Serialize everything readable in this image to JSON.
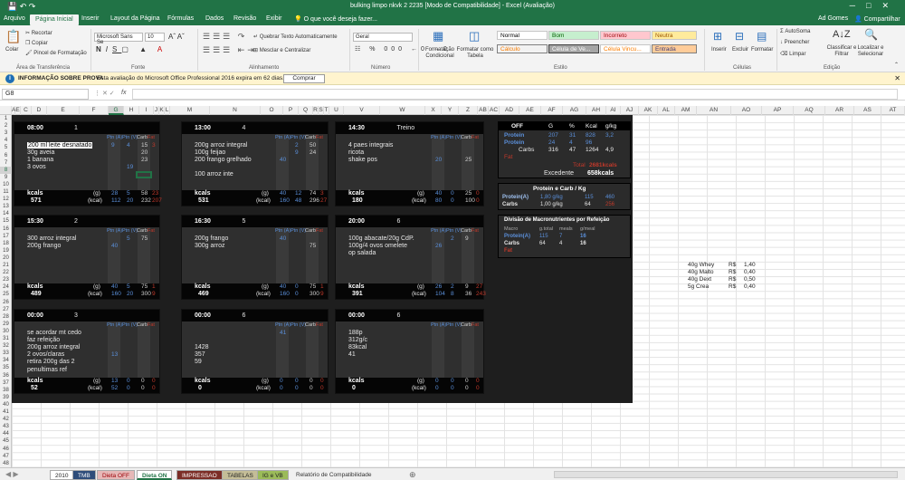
{
  "title": {
    "text": "bulking limpo nkvk 2 2235 [Modo de Compatibilidade] - Excel (Avaliação)",
    "user": "Ad Gomes",
    "share": "Compartilhar"
  },
  "tabs": [
    "Arquivo",
    "Página Inicial",
    "Inserir",
    "Layout da Página",
    "Fórmulas",
    "Dados",
    "Revisão",
    "Exibir",
    "O que você deseja fazer..."
  ],
  "ribbon": {
    "paste": "Colar",
    "cut": "Recortar",
    "copy": "Copiar",
    "painter": "Pincel de Formatação",
    "g_clip": "Área de Transferência",
    "font": "Microsoft Sans Se",
    "size": "10",
    "g_font": "Fonte",
    "wrap": "Quebrar Texto Automaticamente",
    "merge": "Mesclar e Centralizar",
    "g_align": "Alinhamento",
    "numfmt": "Geral",
    "g_num": "Número",
    "cond": "Formatação Condicional",
    "astable": "Formatar como Tabela",
    "styles": [
      "Normal",
      "Bom",
      "Incorreto",
      "Neutra",
      "Cálculo",
      "Célula de Ve...",
      "Célula Vincu...",
      "Entrada"
    ],
    "g_styles": "Estilo",
    "insert": "Inserir",
    "delete": "Excluir",
    "format": "Formatar",
    "g_cells": "Células",
    "autosum": "AutoSoma",
    "fill": "Preencher",
    "clear": "Limpar",
    "sort": "Classificar e Filtrar",
    "find": "Localizar e Selecionar",
    "g_edit": "Edição"
  },
  "info": {
    "label": "INFORMAÇÃO SOBRE PROVA",
    "text": "Esta avaliação do Microsoft Office Professional 2016 expira em 62 dias.",
    "button": "Comprar"
  },
  "formula": {
    "namebox": "G8",
    "fx": "fx"
  },
  "columns": [
    "A",
    "E",
    "C",
    "D",
    "E",
    "F",
    "G",
    "H",
    "I",
    "J",
    "K",
    "L",
    "M",
    "N",
    "O",
    "P",
    "Q",
    "R",
    "S",
    "T",
    "U",
    "V",
    "W",
    "X",
    "Y",
    "Z",
    "AB",
    "AC",
    "AD",
    "AE",
    "AF",
    "AG",
    "AH",
    "AI",
    "AJ",
    "AK",
    "AL",
    "AM",
    "AN",
    "AO",
    "AP",
    "AQ",
    "AR",
    "AS",
    "AT"
  ],
  "rows": [
    "1",
    "2",
    "3",
    "4",
    "5",
    "6",
    "7",
    "8",
    "9",
    "10",
    "11",
    "12",
    "13",
    "14",
    "15",
    "16",
    "17",
    "18",
    "19",
    "20",
    "21",
    "22",
    "23",
    "24",
    "25",
    "26",
    "27",
    "28",
    "29",
    "30",
    "31",
    "32",
    "33",
    "34",
    "35",
    "36",
    "37",
    "38",
    "39",
    "40",
    "41",
    "42",
    "43",
    "44",
    "45",
    "46",
    "47",
    "48"
  ],
  "hdr": {
    "ptn_a": "Ptn (A)",
    "ptn_v": "Ptn (V)",
    "carb": "Carb",
    "fat": "Fat",
    "kcals": "kcals",
    "g": "(g)",
    "kcal": "(kcal)"
  },
  "meals": [
    {
      "time": "08:00",
      "num": "1",
      "items": [
        "200 ml  leite desnatado",
        "30g  aveia",
        "1  banana",
        "3 ovos"
      ],
      "cols": [
        [
          "9",
          "",
          "",
          ""
        ],
        [
          "4",
          "",
          "",
          "19"
        ],
        [
          "15",
          "20",
          "23",
          ""
        ],
        [
          "3",
          "",
          "",
          ""
        ]
      ],
      "kcals": "571",
      "g": [
        "28",
        "5",
        "58",
        "23"
      ],
      "kcal": [
        "112",
        "20",
        "232",
        "207"
      ]
    },
    {
      "time": "13:00",
      "num": "4",
      "items": [
        "200g arroz integral",
        "100g feijao",
        "200 frango grelhado",
        "",
        "100 arroz inte"
      ],
      "cols": [
        [
          "",
          "",
          "40",
          ""
        ],
        [
          "2",
          "9",
          "",
          ""
        ],
        [
          "50",
          "24",
          "",
          ""
        ],
        [
          "",
          "",
          "",
          ""
        ]
      ],
      "kcals": "531",
      "g": [
        "40",
        "12",
        "74",
        "3"
      ],
      "kcal": [
        "160",
        "48",
        "296",
        "27"
      ]
    },
    {
      "time": "14:30",
      "num": "Treino",
      "items": [
        "4 paes integrais",
        "ricota",
        "shake pos"
      ],
      "cols": [
        [
          "",
          "",
          "20",
          ""
        ],
        [
          "",
          "",
          "",
          ""
        ],
        [
          "",
          "",
          "25",
          ""
        ],
        [
          "",
          "",
          "",
          ""
        ]
      ],
      "kcals": "180",
      "g": [
        "40",
        "0",
        "25",
        "0"
      ],
      "kcal": [
        "80",
        "0",
        "100",
        "0"
      ]
    },
    {
      "time": "15:30",
      "num": "2",
      "items": [
        "300 arroz integral",
        "200g frango"
      ],
      "cols": [
        [
          "",
          "40",
          ""
        ],
        [
          "5",
          "",
          ""
        ],
        [
          "75",
          "",
          ""
        ],
        [
          "",
          "",
          ""
        ]
      ],
      "kcals": "489",
      "g": [
        "40",
        "5",
        "75",
        "1"
      ],
      "kcal": [
        "160",
        "20",
        "300",
        "9"
      ]
    },
    {
      "time": "16:30",
      "num": "5",
      "items": [
        "200g frango",
        "300g arroz"
      ],
      "cols": [
        [
          "40",
          ""
        ],
        [
          "",
          ""
        ],
        [
          "",
          "75"
        ],
        [
          "",
          ""
        ]
      ],
      "kcals": "469",
      "g": [
        "40",
        "0",
        "75",
        "1"
      ],
      "kcal": [
        "160",
        "0",
        "300",
        "9"
      ]
    },
    {
      "time": "20:00",
      "num": "6",
      "items": [
        "100g  abacate/20g CdP.",
        "100g/4  ovos omelete",
        "op  salada"
      ],
      "cols": [
        [
          "",
          "26",
          ""
        ],
        [
          "2",
          "",
          ""
        ],
        [
          "9",
          "",
          ""
        ],
        [
          "",
          "",
          ""
        ]
      ],
      "kcals": "391",
      "g": [
        "26",
        "2",
        "9",
        "27"
      ],
      "kcal": [
        "104",
        "8",
        "36",
        "243"
      ]
    },
    {
      "time": "00:00",
      "num": "3",
      "items": [
        "se  acordar mt cedo",
        "faz  refeição",
        "200g  arroz integral",
        "2  ovos/claras",
        "retira 200g das 2",
        "penultimas ref"
      ],
      "cols": [
        [
          "",
          "",
          "",
          "13",
          "",
          ""
        ],
        [
          "",
          "",
          "",
          "",
          "",
          ""
        ],
        [
          "",
          "",
          "",
          "",
          "",
          ""
        ],
        [
          "",
          "",
          "",
          "",
          "",
          ""
        ]
      ],
      "kcals": "52",
      "g": [
        "13",
        "0",
        "0",
        "0"
      ],
      "kcal": [
        "52",
        "0",
        "0",
        "0"
      ]
    },
    {
      "time": "00:00",
      "num": "6",
      "items": [
        "",
        "",
        "1428",
        "357",
        "59"
      ],
      "cols": [
        [
          "41",
          "",
          "",
          "",
          ""
        ],
        [
          "",
          "",
          "",
          "",
          ""
        ],
        [
          "",
          "",
          "",
          "",
          ""
        ],
        [
          "",
          "",
          "",
          "",
          ""
        ]
      ],
      "kcals": "0",
      "g": [
        "0",
        "0",
        "0",
        "0"
      ],
      "kcal": [
        "0",
        "0",
        "0",
        "0"
      ]
    },
    {
      "time": "00:00",
      "num": "6",
      "items": [
        "188p",
        "312g/c",
        "83kcal",
        "41"
      ],
      "cols": [
        [
          "",
          "",
          "",
          ""
        ],
        [
          "",
          "",
          "",
          ""
        ],
        [
          "",
          "",
          "",
          ""
        ],
        [
          "",
          "",
          "",
          ""
        ]
      ],
      "kcals": "0",
      "g": [
        "0",
        "0",
        "0",
        "0"
      ],
      "kcal": [
        "0",
        "0",
        "0",
        "0"
      ]
    }
  ],
  "summary": {
    "head": [
      "OFF",
      "G",
      "%",
      "Kcal",
      "g/kg"
    ],
    "rows": [
      [
        "Protein",
        "207",
        "31",
        "828",
        "3,2"
      ],
      [
        "Protein",
        "24",
        "4",
        "96",
        ""
      ],
      [
        "Carbs",
        "316",
        "47",
        "1264",
        "4,9"
      ],
      [
        "Fat",
        "",
        "",
        "",
        ""
      ]
    ],
    "total_label": "Total",
    "total": "2681kcals",
    "exc_label": "Excedente",
    "exc": "658kcals"
  },
  "pcg": {
    "title": "Protein e Carb / Kg",
    "rows": [
      [
        "Protein(A)",
        "1,80 g/kg",
        "115",
        "460"
      ],
      [
        "Carbs",
        "1,00 g/kg",
        "64",
        "256"
      ]
    ]
  },
  "macro": {
    "title": "Divisão de Macronutrientes por Refeição",
    "head": [
      "Macro",
      "g.total",
      "meals",
      "g/meal"
    ],
    "rows": [
      [
        "Protein(A)",
        "115",
        "7",
        "16"
      ],
      [
        "Carbs",
        "64",
        "4",
        "16"
      ],
      [
        "Fat",
        "",
        "",
        ""
      ]
    ]
  },
  "side": [
    [
      "40g Whey",
      "R$",
      "1,40"
    ],
    [
      "40g Malto",
      "R$",
      "0,40"
    ],
    [
      "40g Dext",
      "R$",
      "0,50"
    ],
    [
      "5g Crea",
      "R$",
      "0,40"
    ]
  ],
  "sheets": [
    "2010",
    "TMB",
    "Dieta OFF",
    "Dieta ON",
    "IMPRESSAO",
    "TABELAS",
    "IG e VB",
    "Relatório de Compatibilidade"
  ],
  "colors": {
    "excel_green": "#217346",
    "blue": "#5b8fd9",
    "red": "#c0392b",
    "yellow": "#d8c43e",
    "dark": "#1e1e1e"
  }
}
